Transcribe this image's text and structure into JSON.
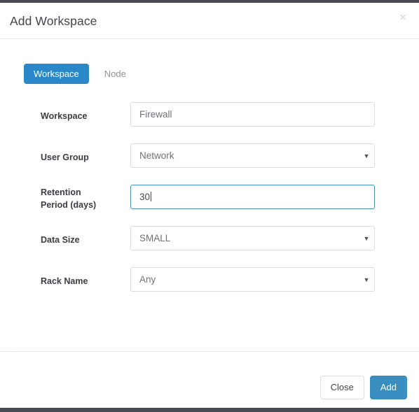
{
  "window": {
    "title": "Add Workspace",
    "close_label": "×",
    "close_icon": "close-icon"
  },
  "tabs": [
    {
      "label": "Workspace",
      "active": true
    },
    {
      "label": "Node",
      "active": false
    }
  ],
  "form": {
    "fields": [
      {
        "label": "Workspace",
        "type": "text",
        "value": "Firewall",
        "placeholder": "Firewall",
        "focused": false
      },
      {
        "label": "User Group",
        "type": "select",
        "value": "Network",
        "arrow_icon": "chevron-down-icon",
        "focused": false
      },
      {
        "label": "Retention\nPeriod (days)",
        "label_line1": "Retention",
        "label_line2": "Period (days)",
        "type": "text",
        "value": "30",
        "focused": true
      },
      {
        "label": "Data Size",
        "type": "select",
        "value": "SMALL",
        "arrow_icon": "chevron-down-icon",
        "focused": false
      },
      {
        "label": "Rack Name",
        "type": "select",
        "value": "Any",
        "arrow_icon": "chevron-down-icon",
        "focused": false
      }
    ]
  },
  "footer": {
    "close_button": "Close",
    "add_button": "Add"
  },
  "colors": {
    "accent_blue": "#2a87c8",
    "primary_button": "#3a8dbf",
    "focus_border": "#3e96bf",
    "label_text": "#3b3d42",
    "field_text": "#6f7276",
    "border": "#dcdcdc",
    "chrome": "#4a4a52"
  },
  "select_arrow_glyph": "▼"
}
